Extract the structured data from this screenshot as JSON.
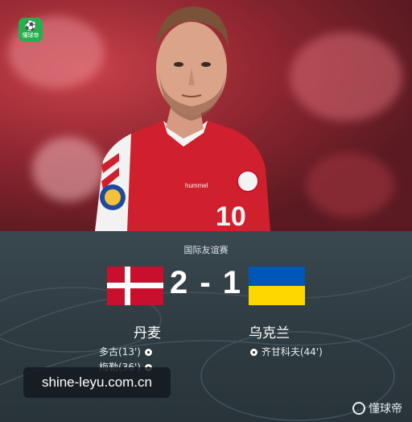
{
  "app": {
    "logo_text": "懂球帝"
  },
  "match": {
    "competition": "国际友谊赛",
    "score": "2 - 1",
    "home": {
      "name": "丹麦",
      "scorers": [
        "多古(13')",
        "梅勒(36')"
      ]
    },
    "away": {
      "name": "乌克兰",
      "scorers": [
        "齐甘科夫(44')"
      ]
    }
  },
  "watermark": "shine-leyu.com.cn",
  "brand": "懂球帝",
  "player": {
    "shirt_number": "10",
    "kit_brand": "hummel"
  },
  "colors": {
    "denmark_red": "#c8102e",
    "ukraine_blue": "#0057b7",
    "ukraine_yellow": "#ffd700",
    "logo_green": "#22b14c"
  }
}
